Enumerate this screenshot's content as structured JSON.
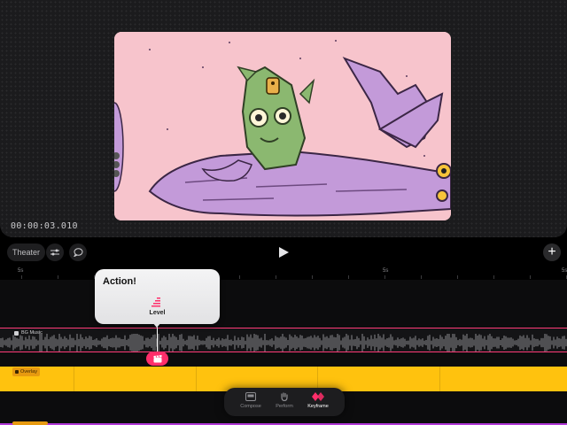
{
  "preview": {
    "timecode": "00:00:03.010"
  },
  "toolbar": {
    "theater_label": "Theater",
    "icons": [
      "sliders-icon",
      "speech-bubble-icon",
      "play-icon",
      "plus-icon"
    ]
  },
  "ruler": {
    "labels": [
      "5s",
      "5s",
      "5s"
    ]
  },
  "popover": {
    "title": "Action!",
    "level_label": "Level"
  },
  "tracks": {
    "music_label": "BG Music",
    "overlay_label": "Overlay"
  },
  "modes": {
    "compose": "Compose",
    "perform": "Perform",
    "keyframe": "Keyframe",
    "active": "keyframe"
  },
  "colors": {
    "accent_pink": "#ff2e6a",
    "overlay_yellow": "#ffc20e",
    "video_bg": "#f7c4cc"
  }
}
